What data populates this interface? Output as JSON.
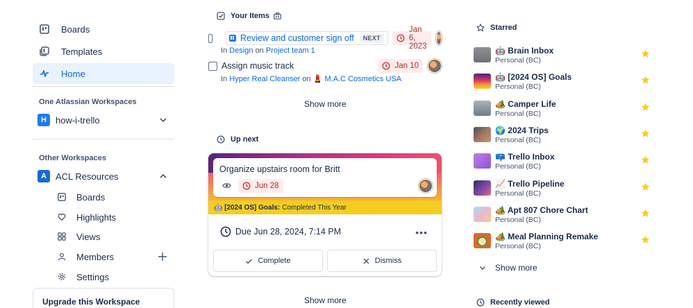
{
  "sidebar": {
    "top_items": [
      {
        "label": "Boards",
        "icon": "board-icon"
      },
      {
        "label": "Templates",
        "icon": "templates-icon"
      },
      {
        "label": "Home",
        "icon": "activity-icon",
        "active": true
      }
    ],
    "one_atlassian_heading": "One Atlassian Workspaces",
    "workspace_1": {
      "initial": "H",
      "name": "how-i-trello",
      "color": "#1d7afc"
    },
    "other_heading": "Other Workspaces",
    "workspace_2": {
      "initial": "A",
      "name": "ACL Resources",
      "color": "#1868db"
    },
    "sub_items": [
      {
        "label": "Boards",
        "icon": "board-icon"
      },
      {
        "label": "Highlights",
        "icon": "heart-icon"
      },
      {
        "label": "Views",
        "icon": "grid-icon"
      },
      {
        "label": "Members",
        "icon": "person-icon"
      },
      {
        "label": "Settings",
        "icon": "gear-icon"
      }
    ],
    "upgrade_label": "Upgrade this Workspace"
  },
  "your_items": {
    "heading": "Your Items",
    "items": [
      {
        "title": "Review and customer sign off",
        "badge": "NEXT",
        "due": "Jan 6, 2023",
        "meta_prefix": "In",
        "meta_list": "Design",
        "meta_on": "on",
        "meta_board": "Project team 1"
      },
      {
        "title": "Assign music track",
        "due": "Jan 10",
        "meta_prefix": "In",
        "meta_list": "Hyper Real Cleanser",
        "meta_on": "on",
        "meta_board": "💄 M.A.C Cosmetics USA"
      }
    ],
    "show_more": "Show more"
  },
  "up_next": {
    "heading": "Up next",
    "card_title": "Organize upstairs room for Britt",
    "card_due": "Jun 28",
    "board_name": "🤖 [2024 OS] Goals:",
    "list_name": "Completed This Year",
    "due_full": "Due Jun 28, 2024, 7:14 PM",
    "more": "•••",
    "complete_label": "Complete",
    "dismiss_label": "Dismiss",
    "show_more": "Show more"
  },
  "starred": {
    "heading": "Starred",
    "boards": [
      {
        "name": "🤖 Brain Inbox",
        "workspace": "Personal (BC)",
        "thumb": "#7b7d82"
      },
      {
        "name": "🤖 [2024 OS] Goals",
        "workspace": "Personal (BC)",
        "thumb": "#d8355f"
      },
      {
        "name": "🏕️ Camper Life",
        "workspace": "Personal (BC)",
        "thumb": "#8a9aa8"
      },
      {
        "name": "🌍 2024 Trips",
        "workspace": "Personal (BC)",
        "thumb": "#8a6a5e"
      },
      {
        "name": "📪 Trello Inbox",
        "workspace": "Personal (BC)",
        "thumb": "#a76bd8"
      },
      {
        "name": "📈 Trello Pipeline",
        "workspace": "Personal (BC)",
        "thumb": "#5d3d8c"
      },
      {
        "name": "🏕️ Apt 807 Chore Chart",
        "workspace": "Personal (BC)",
        "thumb": "#e9b7c8"
      },
      {
        "name": "🏕️ Meal Planning Remake",
        "workspace": "Personal (BC)",
        "thumb": "#d96a2b"
      }
    ],
    "show_more": "Show more",
    "star_color": "#f5cd1f"
  },
  "recently_viewed": {
    "heading": "Recently viewed"
  }
}
